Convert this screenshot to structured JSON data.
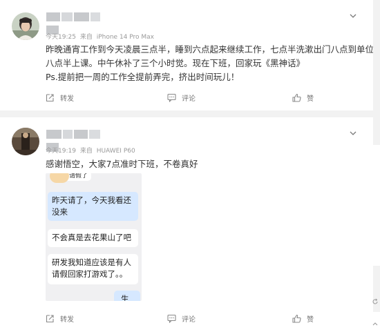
{
  "posts": [
    {
      "meta": {
        "time": "今天19:25",
        "source_prefix": "来自",
        "device": "iPhone 14 Pro Max"
      },
      "lines": [
        "昨晚通宵工作到今天凌晨三点半，睡到六点起来继续工作，七点半洗漱出门八点到单位",
        "八点半上课。中午休补了三个小时觉。现在下班，回家玩《黑神话》",
        "Ps.提前把一周的工作全提前弄完，挤出时间玩儿！"
      ],
      "actions": {
        "repost": "转发",
        "comment": "评论",
        "like": "赞"
      }
    },
    {
      "meta": {
        "time": "今天19:19",
        "source_prefix": "来自",
        "device": "HUAWEI P60"
      },
      "lines": [
        "感谢悟空，大家7点准时下班，不卷真好"
      ],
      "image": {
        "top_snippet": "请假了",
        "bubbles": [
          {
            "line1": "昨天请了，今天我看还",
            "line2": "没来"
          },
          {
            "line1": "不会真是去花果山了吧",
            "line2": ""
          },
          {
            "line1": "研发我知道应该是有人",
            "line2": "请假回家打游戏了。。"
          },
          {
            "line1": "生网",
            "line2": ""
          }
        ]
      },
      "actions": {
        "repost": "转发",
        "comment": "评论",
        "like": "赞"
      }
    }
  ],
  "icons": {
    "more": "chevron-down-icon",
    "repost": "repost-icon",
    "comment": "comment-icon",
    "like": "thumbs-up-icon"
  },
  "colors": {
    "text": "#333333",
    "meta": "#999999",
    "page_bg": "#f2f2f2",
    "bubble_me": "#d6e8ff"
  }
}
